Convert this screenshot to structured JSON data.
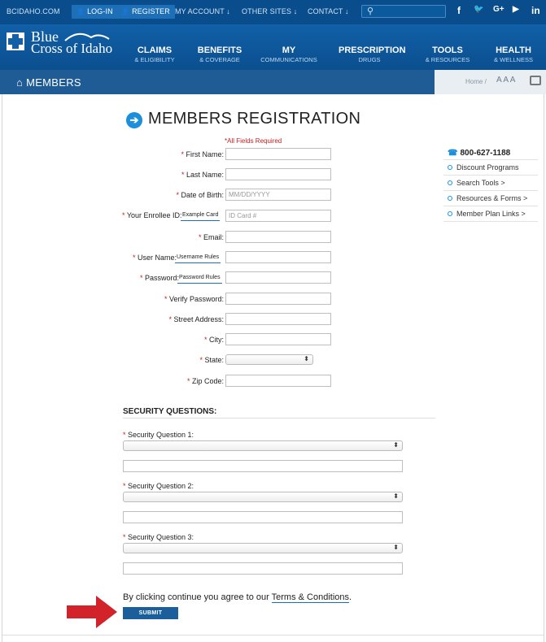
{
  "topbar": {
    "site": "BCIDAHO.COM",
    "login": "LOG-IN",
    "register": "REGISTER",
    "my_account": "MY ACCOUNT ↓",
    "other_sites": "OTHER SITES ↓",
    "contact": "CONTACT ↓",
    "social": [
      "f",
      "🐦",
      "G+",
      "▶",
      "in"
    ]
  },
  "header": {
    "logo_line1": "Blue",
    "logo_line2": "Cross of Idaho",
    "nav": [
      {
        "title": "CLAIMS",
        "sub": "& ELIGIBILITY"
      },
      {
        "title": "BENEFITS",
        "sub": "& COVERAGE"
      },
      {
        "title": "MY",
        "sub": "COMMUNICATIONS"
      },
      {
        "title": "PRESCRIPTION",
        "sub": "DRUGS"
      },
      {
        "title": "TOOLS",
        "sub": "& RESOURCES"
      },
      {
        "title": "HEALTH",
        "sub": "& WELLNESS"
      }
    ]
  },
  "strip": {
    "section": "MEMBERS",
    "breadcrumb": "Home /",
    "text_size": "A A A"
  },
  "page": {
    "title": "MEMBERS REGISTRATION",
    "required_note": "*All Fields Required"
  },
  "form": {
    "first_name": "First Name:",
    "last_name": "Last Name:",
    "dob": "Date of Birth:",
    "dob_placeholder": "MM/DD/YYYY",
    "enrollee_id": "Your Enrollee ID:",
    "example_card": "Example Card",
    "id_placeholder": "ID Card #",
    "email": "Email:",
    "username": "User Name:",
    "username_rules": "Username Rules",
    "password": "Password:",
    "password_rules": "Password Rules",
    "verify_password": "Verify Password:",
    "street": "Street Address:",
    "city": "City:",
    "state": "State:",
    "zip": "Zip Code:"
  },
  "sidebar": {
    "phone": "800-627-1188",
    "items": [
      "Discount Programs",
      "Search Tools >",
      "Resources & Forms >",
      "Member Plan Links >"
    ]
  },
  "security": {
    "title": "SECURITY QUESTIONS:",
    "q1": "Security Question 1:",
    "q2": "Security Question 2:",
    "q3": "Security Question 3:"
  },
  "footer": {
    "agree_prefix": "By clicking continue you agree to our ",
    "terms": "Terms & Conditions",
    "agree_suffix": ".",
    "submit": "SUBMIT"
  },
  "colors": {
    "brand_blue": "#0a4d8c",
    "accent_blue": "#1b8fdb",
    "required_red": "#c41e1e",
    "arrow_red": "#d2232a"
  }
}
